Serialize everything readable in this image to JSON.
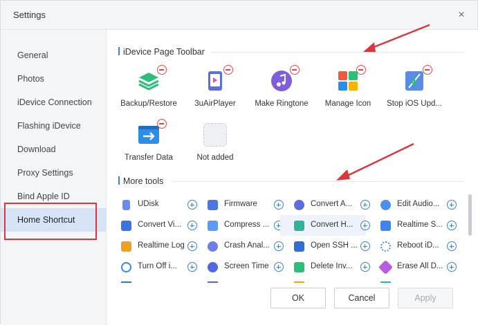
{
  "window": {
    "title": "Settings",
    "close_glyph": "×"
  },
  "sidebar": {
    "items": [
      {
        "label": "General",
        "active": false
      },
      {
        "label": "Photos",
        "active": false
      },
      {
        "label": "iDevice Connection",
        "active": false
      },
      {
        "label": "Flashing iDevice",
        "active": false
      },
      {
        "label": "Download",
        "active": false
      },
      {
        "label": "Proxy Settings",
        "active": false
      },
      {
        "label": "Bind Apple ID",
        "active": false
      },
      {
        "label": "Home Shortcut",
        "active": true
      }
    ]
  },
  "toolbar_section": {
    "heading": "iDevice Page Toolbar",
    "tools": [
      {
        "label": "Backup/Restore",
        "icon": "layers-icon",
        "color": "#2bbf7a"
      },
      {
        "label": "3uAirPlayer",
        "icon": "tablet-play-icon",
        "color": "#5b6ee1"
      },
      {
        "label": "Make Ringtone",
        "icon": "music-note-icon",
        "color": "#7f5fd9"
      },
      {
        "label": "Manage Icon",
        "icon": "grid-tiles-icon",
        "color": "#f05a3c"
      },
      {
        "label": "Stop iOS Upd...",
        "icon": "update-block-icon",
        "color": "#5a8be6"
      },
      {
        "label": "Transfer Data",
        "icon": "transfer-arrow-icon",
        "color": "#2d8ee8"
      },
      {
        "label": "Not added",
        "icon": "empty-slot-icon",
        "color": "#e6e8ec"
      }
    ]
  },
  "more_section": {
    "heading": "More tools",
    "rows": [
      [
        {
          "label": "UDisk",
          "icon": "usb-icon",
          "color": "#6b8cf0"
        },
        {
          "label": "Firmware",
          "icon": "firmware-icon",
          "color": "#4a78e0"
        },
        {
          "label": "Convert A...",
          "icon": "audio-wave-icon",
          "color": "#5b6ee1"
        },
        {
          "label": "Edit Audio...",
          "icon": "edit-audio-icon",
          "color": "#4c8ff0"
        }
      ],
      [
        {
          "label": "Convert Vi...",
          "icon": "video-convert-icon",
          "color": "#3d73e0"
        },
        {
          "label": "Compress ...",
          "icon": "compress-image-icon",
          "color": "#5b9cf2"
        },
        {
          "label": "Convert H...",
          "icon": "heic-convert-icon",
          "color": "#2fb39a"
        },
        {
          "label": "Realtime S...",
          "icon": "realtime-screen-icon",
          "color": "#3e84ec"
        }
      ],
      [
        {
          "label": "Realtime Log",
          "icon": "log-icon",
          "color": "#f0a020"
        },
        {
          "label": "Crash Anal...",
          "icon": "crash-analysis-icon",
          "color": "#6c7fe8"
        },
        {
          "label": "Open SSH ...",
          "icon": "terminal-icon",
          "color": "#2e6fd8"
        },
        {
          "label": "Reboot iD...",
          "icon": "reboot-spinner-icon",
          "color": "#4d8bf0"
        }
      ],
      [
        {
          "label": "Turn Off i...",
          "icon": "power-icon",
          "color": "#3d83ea"
        },
        {
          "label": "Screen Time",
          "icon": "clock-icon",
          "color": "#5268e0"
        },
        {
          "label": "Delete Inv...",
          "icon": "trash-icon",
          "color": "#2bbf7a"
        },
        {
          "label": "Erase All D...",
          "icon": "eraser-icon",
          "color": "#b65ee0"
        }
      ]
    ]
  },
  "buttons": {
    "ok": "OK",
    "cancel": "Cancel",
    "apply": "Apply"
  },
  "colors": {
    "accent": "#3c7fd6",
    "remove": "#e04848",
    "annotation": "#d9363e"
  }
}
